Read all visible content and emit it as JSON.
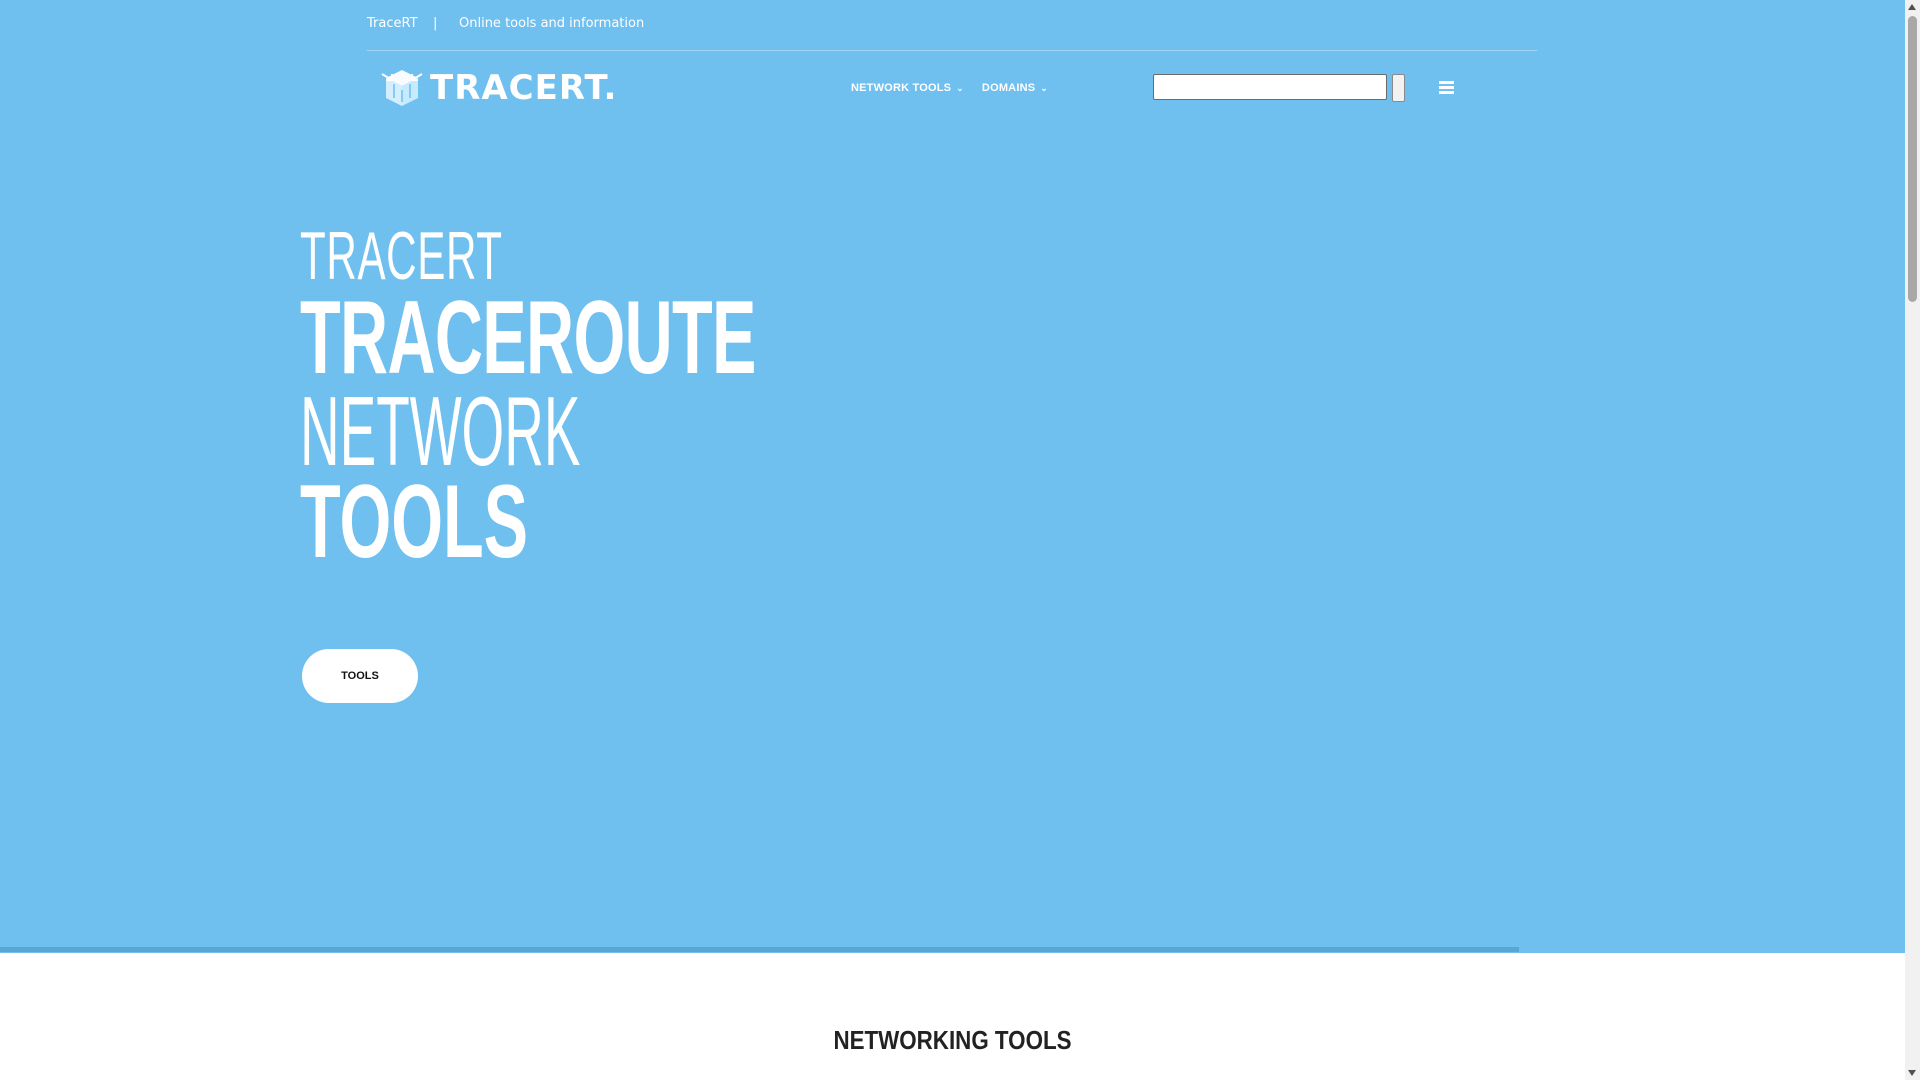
{
  "topbar": {
    "site_name": "TraceRT",
    "separator": "|",
    "tagline": "Online tools and information"
  },
  "logo": {
    "text": "TRACERT.",
    "icon": "cube-arrows-logo-icon"
  },
  "nav": {
    "items": [
      {
        "label": "NETWORK TOOLS",
        "icon": "chevron-down-icon"
      },
      {
        "label": "DOMAINS",
        "icon": "chevron-down-icon"
      }
    ]
  },
  "search": {
    "value": "",
    "placeholder": ""
  },
  "hero": {
    "line1": "TRACERT",
    "line2": "TRACEROUTE",
    "line3": "NETWORK",
    "line4": "TOOLS",
    "button_label": "TOOLS",
    "background_color": "#6fbfef"
  },
  "section": {
    "title": "NETWORKING TOOLS"
  }
}
